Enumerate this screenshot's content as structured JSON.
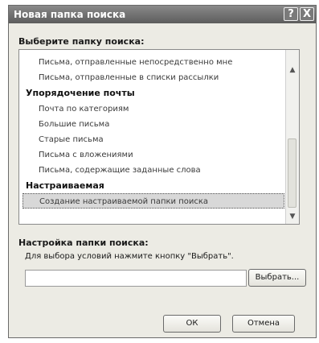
{
  "dialog": {
    "title": "Новая папка поиска",
    "help_glyph": "?",
    "close_glyph": "X"
  },
  "folder_section": {
    "label": "Выберите папку поиска:",
    "list": [
      {
        "kind": "item",
        "text": "Письма, отправленные непосредственно мне"
      },
      {
        "kind": "item",
        "text": "Письма, отправленные в списки рассылки"
      },
      {
        "kind": "category",
        "text": "Упорядочение почты"
      },
      {
        "kind": "item",
        "text": "Почта по категориям"
      },
      {
        "kind": "item",
        "text": "Большие письма"
      },
      {
        "kind": "item",
        "text": "Старые письма"
      },
      {
        "kind": "item",
        "text": "Письма с вложениями"
      },
      {
        "kind": "item",
        "text": "Письма, содержащие заданные слова"
      },
      {
        "kind": "category",
        "text": "Настраиваемая"
      },
      {
        "kind": "item",
        "text": "Создание настраиваемой папки поиска",
        "selected": true
      }
    ],
    "scroll_up_glyph": "▲",
    "scroll_down_glyph": "▼"
  },
  "settings_section": {
    "label": "Настройка папки поиска:",
    "hint": "Для выбора условий нажмите кнопку \"Выбрать\".",
    "value": "",
    "choose_button": "Выбрать..."
  },
  "footer": {
    "ok_button": "ОК",
    "cancel_button": "Отмена"
  }
}
